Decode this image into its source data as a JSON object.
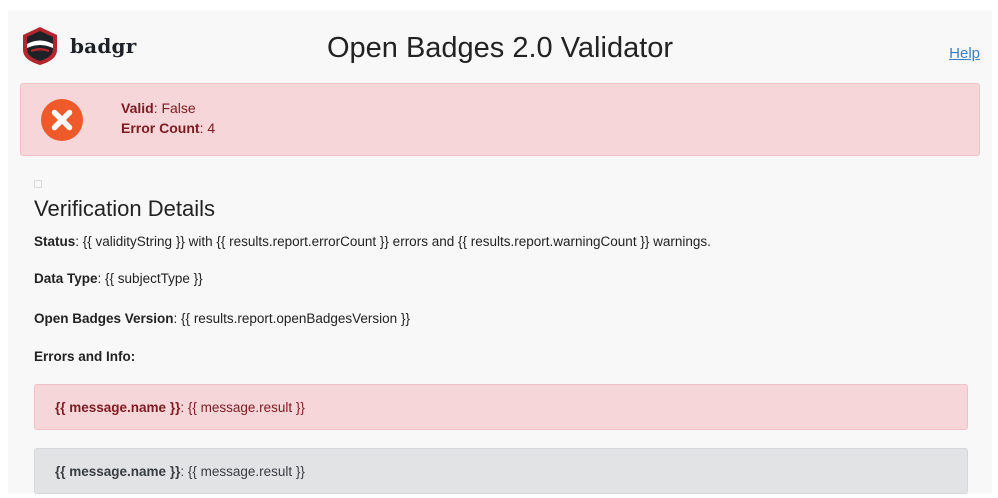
{
  "header": {
    "logo_text": "badgr",
    "title": "Open Badges 2.0 Validator",
    "help_label": "Help"
  },
  "result_alert": {
    "valid_label": "Valid",
    "valid_value": ": False",
    "error_count_label": "Error Count",
    "error_count_value": ": 4",
    "icon": "error-x-circle-icon",
    "icon_color": "#ef5a2a",
    "background_color": "#f6d6d8"
  },
  "details": {
    "title": "Verification Details",
    "status_label": "Status",
    "status_value": ": {{ validityString }} with {{ results.report.errorCount }} errors and {{ results.report.warningCount }} warnings.",
    "data_type_label": "Data Type",
    "data_type_value": ": {{ subjectType }}",
    "version_label": "Open Badges Version",
    "version_value": ": {{ results.report.openBadgesVersion }}",
    "errors_info_label": "Errors and Info:"
  },
  "messages": [
    {
      "name": "{{ message.name }}",
      "result": ": {{ message.result }}",
      "level": "error"
    },
    {
      "name": "{{ message.name }}",
      "result": ": {{ message.result }}",
      "level": "info"
    }
  ]
}
